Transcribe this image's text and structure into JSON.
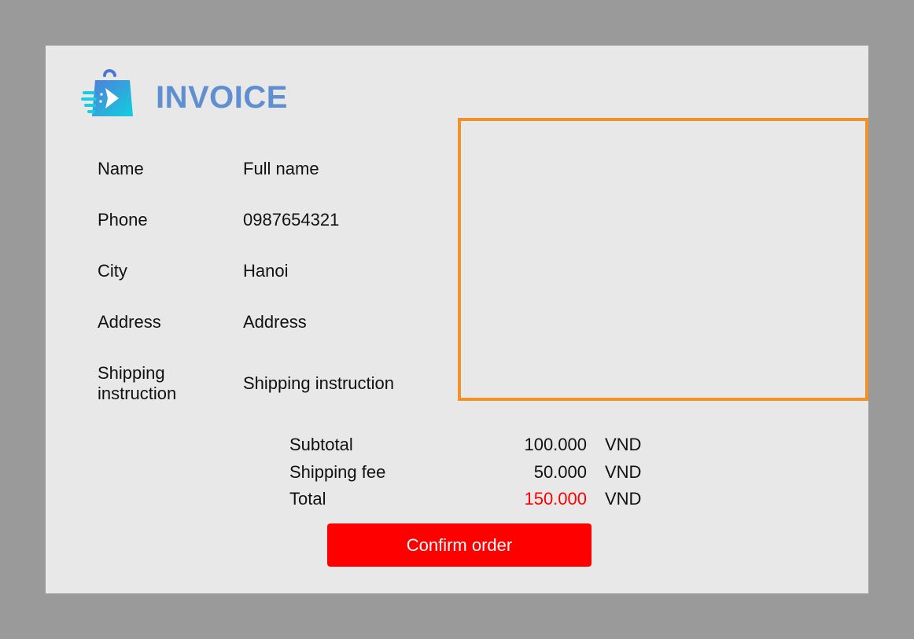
{
  "header": {
    "title": "INVOICE",
    "logo_icon": "shopping-bag-fast-delivery-icon"
  },
  "customer": [
    {
      "label": "Name",
      "value": "Full name"
    },
    {
      "label": "Phone",
      "value": "0987654321"
    },
    {
      "label": "City",
      "value": "Hanoi"
    },
    {
      "label": "Address",
      "value": "Address"
    },
    {
      "label": "Shipping instruction",
      "value": "Shipping instruction"
    }
  ],
  "summary": {
    "subtotal_label": "Subtotal",
    "subtotal_amount": "100.000",
    "shipping_fee_label": "Shipping fee",
    "shipping_fee_amount": "50.000",
    "total_label": "Total",
    "total_amount": "150.000",
    "currency": "VND"
  },
  "actions": {
    "confirm_label": "Confirm order"
  },
  "colors": {
    "title": "#5f8fd0",
    "highlight_border": "#f0922a",
    "total_amount": "#ff0000",
    "button_background": "#ff0000",
    "button_text": "#ffffff"
  }
}
